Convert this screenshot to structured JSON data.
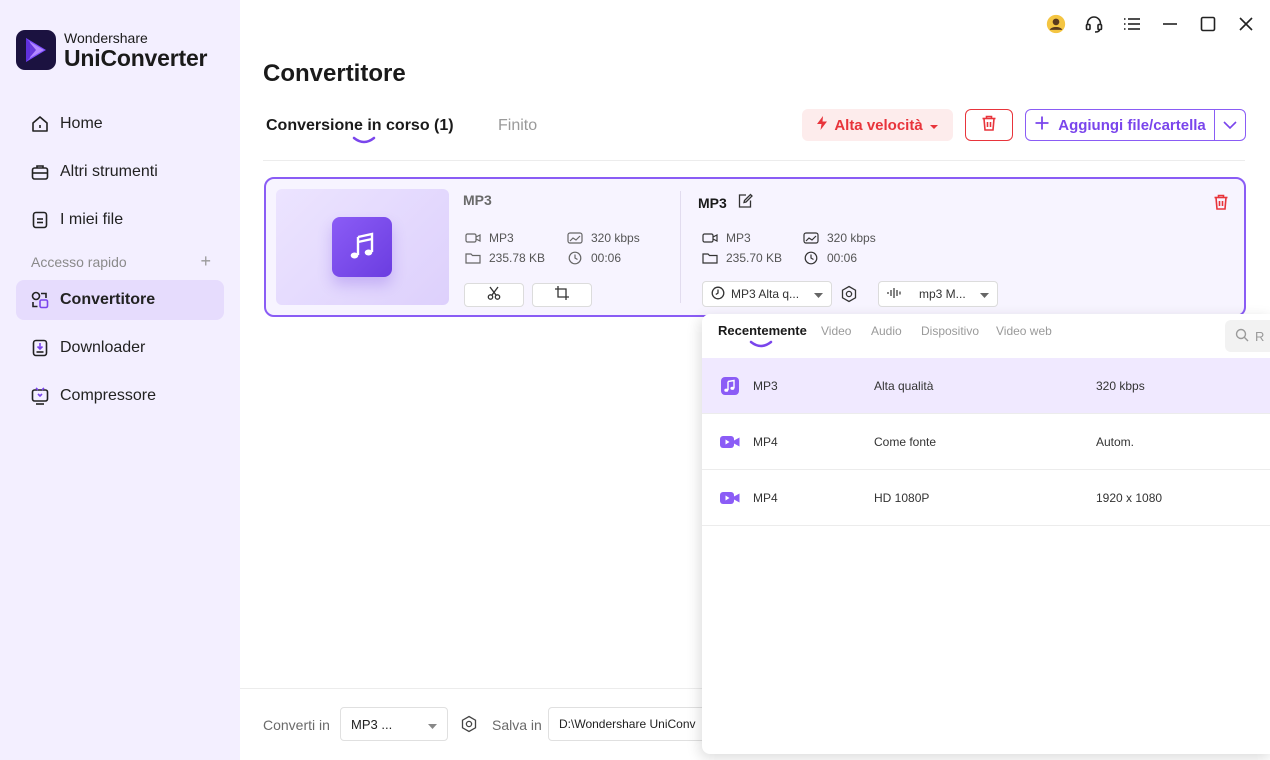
{
  "app": {
    "brand": "Wondershare",
    "product": "UniConverter"
  },
  "sidebar": {
    "items": [
      {
        "label": "Home",
        "icon": "home-icon"
      },
      {
        "label": "Altri strumenti",
        "icon": "toolbox-icon"
      },
      {
        "label": "I miei file",
        "icon": "file-icon"
      }
    ],
    "quick_access_label": "Accesso rapido",
    "quick_items": [
      {
        "label": "Convertitore",
        "icon": "converter-icon",
        "active": true
      },
      {
        "label": "Downloader",
        "icon": "downloader-icon"
      },
      {
        "label": "Compressore",
        "icon": "compressor-icon"
      }
    ]
  },
  "header": {
    "title": "Convertitore",
    "tabs": [
      {
        "label": "Conversione in corso (1)",
        "active": true
      },
      {
        "label": "Finito",
        "active": false
      }
    ],
    "speed_button": "Alta velocità",
    "add_button": "Aggiungi file/cartella"
  },
  "file": {
    "source": {
      "name": "MP3",
      "format": "MP3",
      "bitrate": "320 kbps",
      "size": "235.78 KB",
      "duration": "00:06"
    },
    "target": {
      "name": "MP3",
      "format": "MP3",
      "bitrate": "320 kbps",
      "size": "235.70 KB",
      "duration": "00:06",
      "preset_select": "MP3 Alta q...",
      "audio_select": "mp3 M..."
    }
  },
  "format_panel": {
    "tabs": [
      "Recentemente",
      "Video",
      "Audio",
      "Dispositivo",
      "Video web"
    ],
    "search_placeholder": "R",
    "rows": [
      {
        "format": "MP3",
        "quality": "Alta qualità",
        "spec": "320 kbps",
        "selected": true,
        "icon": "music-note-icon"
      },
      {
        "format": "MP4",
        "quality": "Come fonte",
        "spec": "Autom.",
        "selected": false,
        "icon": "video-camera-icon"
      },
      {
        "format": "MP4",
        "quality": "HD 1080P",
        "spec": "1920 x 1080",
        "selected": false,
        "icon": "video-camera-icon"
      }
    ]
  },
  "bottom": {
    "convert_label": "Converti in",
    "convert_value": "MP3 ...",
    "save_label": "Salva in",
    "save_path": "D:\\Wondershare UniConv"
  },
  "colors": {
    "accent": "#7a45ec",
    "danger": "#e8343b",
    "sidebar_bg": "#f3efff",
    "active_nav": "#e6dcfd"
  }
}
